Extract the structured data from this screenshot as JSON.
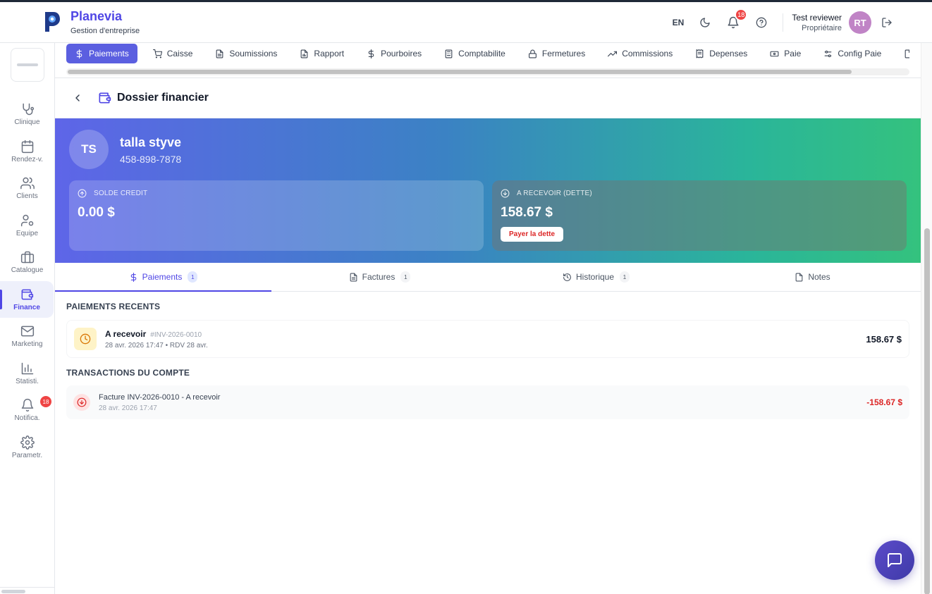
{
  "header": {
    "brand_title": "Planevia",
    "brand_subtitle": "Gestion d'entreprise",
    "language": "EN",
    "notification_count": "18",
    "user_name": "Test reviewer",
    "user_role": "Propriétaire",
    "user_initials": "RT"
  },
  "sidebar": {
    "items": [
      {
        "label": "Clinique",
        "icon": "stethoscope-icon"
      },
      {
        "label": "Rendez-v.",
        "icon": "calendar-icon"
      },
      {
        "label": "Clients",
        "icon": "users-icon"
      },
      {
        "label": "Equipe",
        "icon": "user-cog-icon"
      },
      {
        "label": "Catalogue",
        "icon": "briefcase-icon"
      },
      {
        "label": "Finance",
        "icon": "wallet-icon",
        "active": true
      },
      {
        "label": "Marketing",
        "icon": "mail-icon"
      },
      {
        "label": "Statisti.",
        "icon": "bar-chart-icon"
      },
      {
        "label": "Notifica.",
        "icon": "bell-icon",
        "badge": "18"
      },
      {
        "label": "Parametr.",
        "icon": "gear-icon"
      }
    ]
  },
  "tabs": [
    {
      "label": "Paiements",
      "icon": "dollar-icon",
      "active": true
    },
    {
      "label": "Caisse",
      "icon": "cart-icon"
    },
    {
      "label": "Soumissions",
      "icon": "document-icon"
    },
    {
      "label": "Rapport",
      "icon": "file-chart-icon"
    },
    {
      "label": "Pourboires",
      "icon": "dollar-icon"
    },
    {
      "label": "Comptabilite",
      "icon": "calculator-icon"
    },
    {
      "label": "Fermetures",
      "icon": "lock-icon"
    },
    {
      "label": "Commissions",
      "icon": "trending-up-icon"
    },
    {
      "label": "Depenses",
      "icon": "receipt-icon"
    },
    {
      "label": "Paie",
      "icon": "banknote-icon"
    },
    {
      "label": "Config Paie",
      "icon": "sliders-icon"
    }
  ],
  "page": {
    "title": "Dossier financier"
  },
  "client": {
    "initials": "TS",
    "name": "talla styve",
    "phone": "458-898-7878"
  },
  "cards": {
    "credit_label": "SOLDE CREDIT",
    "credit_value": "0.00 $",
    "debt_label": "A RECEVOIR (DETTE)",
    "debt_value": "158.67 $",
    "pay_button": "Payer la dette"
  },
  "content_tabs": [
    {
      "label": "Paiements",
      "count": "1",
      "icon": "dollar-icon",
      "active": true
    },
    {
      "label": "Factures",
      "count": "1",
      "icon": "document-icon"
    },
    {
      "label": "Historique",
      "count": "1",
      "icon": "history-icon"
    },
    {
      "label": "Notes",
      "icon": "note-icon"
    }
  ],
  "recent_payments": {
    "title": "PAIEMENTS RECENTS",
    "items": [
      {
        "status": "A recevoir",
        "ref": "#INV-2026-0010",
        "meta": "28 avr. 2026 17:47 • RDV 28 avr.",
        "amount": "158.67 $"
      }
    ]
  },
  "transactions": {
    "title": "TRANSACTIONS DU COMPTE",
    "items": [
      {
        "label": "Facture INV-2026-0010 - A recevoir",
        "date": "28 avr. 2026 17:47",
        "amount": "-158.67 $"
      }
    ]
  },
  "colors": {
    "accent": "#4f46e5",
    "danger": "#dc2626",
    "gradient_start": "#5e65e8",
    "gradient_end": "#34c27e"
  }
}
